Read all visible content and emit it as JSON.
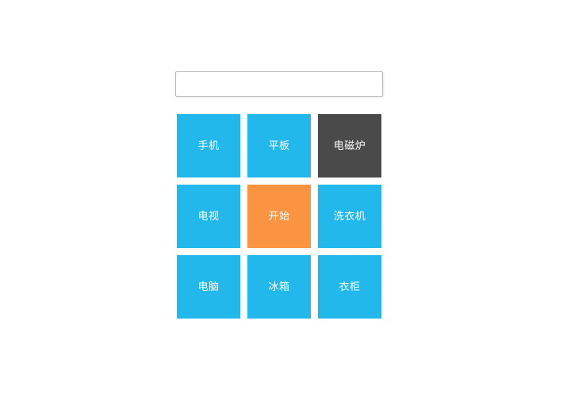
{
  "search": {
    "value": "",
    "placeholder": ""
  },
  "palette": {
    "blue": "#22b8ec",
    "orange": "#fa9440",
    "dark": "#4a4a4a",
    "background": "#ffffff",
    "label": "#ffffff",
    "input_border": "#b9b9b9"
  },
  "grid": {
    "columns": 3,
    "rows": 3,
    "tiles": [
      {
        "label": "手机",
        "color": "blue"
      },
      {
        "label": "平板",
        "color": "blue"
      },
      {
        "label": "电磁炉",
        "color": "dark"
      },
      {
        "label": "电视",
        "color": "blue"
      },
      {
        "label": "开始",
        "color": "orange"
      },
      {
        "label": "洗衣机",
        "color": "blue"
      },
      {
        "label": "电脑",
        "color": "blue"
      },
      {
        "label": "冰箱",
        "color": "blue"
      },
      {
        "label": "衣柜",
        "color": "blue"
      }
    ]
  }
}
